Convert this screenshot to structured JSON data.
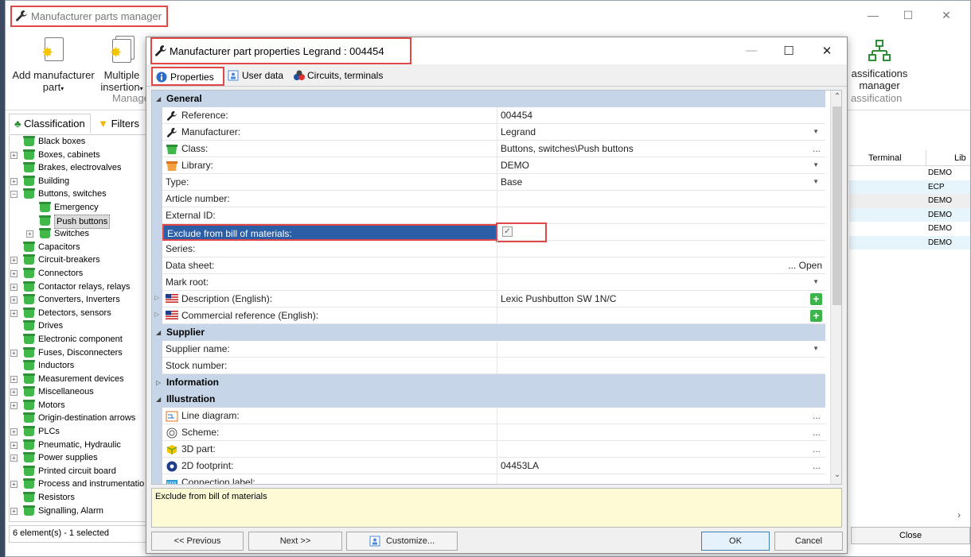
{
  "bg_window": {
    "title": "Manufacturer parts manager",
    "ribbon": {
      "add_manufacturer_part": [
        "Add manufacturer",
        "part"
      ],
      "multiple_insertion": [
        "Multiple",
        "insertion"
      ],
      "group_label": "Manage",
      "classifications_manager": [
        "assifications",
        "manager"
      ],
      "classification_label": "assification"
    },
    "left_tabs": [
      "Classification",
      "Filters"
    ],
    "tree": [
      {
        "label": "Black boxes",
        "level": 1,
        "expander": ""
      },
      {
        "label": "Boxes, cabinets",
        "level": 1,
        "expander": "+"
      },
      {
        "label": "Brakes, electrovalves",
        "level": 1,
        "expander": ""
      },
      {
        "label": "Building",
        "level": 1,
        "expander": "+"
      },
      {
        "label": "Buttons, switches",
        "level": 1,
        "expander": "−"
      },
      {
        "label": "Emergency",
        "level": 2,
        "expander": ""
      },
      {
        "label": "Push buttons",
        "level": 2,
        "expander": "",
        "selected": true
      },
      {
        "label": "Switches",
        "level": 2,
        "expander": "+"
      },
      {
        "label": "Capacitors",
        "level": 1,
        "expander": ""
      },
      {
        "label": "Circuit-breakers",
        "level": 1,
        "expander": "+"
      },
      {
        "label": "Connectors",
        "level": 1,
        "expander": "+"
      },
      {
        "label": "Contactor relays, relays",
        "level": 1,
        "expander": "+"
      },
      {
        "label": "Converters, Inverters",
        "level": 1,
        "expander": "+"
      },
      {
        "label": "Detectors, sensors",
        "level": 1,
        "expander": "+"
      },
      {
        "label": "Drives",
        "level": 1,
        "expander": ""
      },
      {
        "label": "Electronic component",
        "level": 1,
        "expander": ""
      },
      {
        "label": "Fuses, Disconnecters",
        "level": 1,
        "expander": "+"
      },
      {
        "label": "Inductors",
        "level": 1,
        "expander": ""
      },
      {
        "label": "Measurement devices",
        "level": 1,
        "expander": "+"
      },
      {
        "label": "Miscellaneous",
        "level": 1,
        "expander": "+"
      },
      {
        "label": "Motors",
        "level": 1,
        "expander": "+"
      },
      {
        "label": "Origin-destination arrows",
        "level": 1,
        "expander": ""
      },
      {
        "label": "PLCs",
        "level": 1,
        "expander": "+"
      },
      {
        "label": "Pneumatic, Hydraulic",
        "level": 1,
        "expander": "+"
      },
      {
        "label": "Power supplies",
        "level": 1,
        "expander": "+"
      },
      {
        "label": "Printed circuit board",
        "level": 1,
        "expander": ""
      },
      {
        "label": "Process and instrumentatio",
        "level": 1,
        "expander": "+"
      },
      {
        "label": "Resistors",
        "level": 1,
        "expander": ""
      },
      {
        "label": "Signalling, Alarm",
        "level": 1,
        "expander": "+"
      }
    ],
    "status": "6 element(s) - 1 selected",
    "right_table": {
      "headers": [
        "Terminal",
        "Lib"
      ],
      "rows": [
        "DEMO",
        "ECP",
        "DEMO",
        "DEMO",
        "DEMO",
        "DEMO"
      ]
    },
    "close_label": "Close"
  },
  "dialog": {
    "title": "Manufacturer part properties Legrand : 004454",
    "tabs": [
      "Properties",
      "User data",
      "Circuits, terminals"
    ],
    "categories": {
      "general": "General",
      "supplier": "Supplier",
      "information": "Information",
      "illustration": "Illustration"
    },
    "general_rows": [
      {
        "name": "Reference:",
        "value": "004454",
        "icon": "wrench-icon"
      },
      {
        "name": "Manufacturer:",
        "value": "Legrand",
        "icon": "wrench-icon",
        "control": "dropdown"
      },
      {
        "name": "Class:",
        "value": "Buttons, switches\\Push buttons",
        "icon": "green-bucket-icon",
        "control": "dots"
      },
      {
        "name": "Library:",
        "value": "DEMO",
        "icon": "orange-bucket-icon",
        "control": "dropdown"
      },
      {
        "name": "Type:",
        "value": "Base",
        "control": "dropdown"
      },
      {
        "name": "Article number:",
        "value": ""
      },
      {
        "name": "External ID:",
        "value": ""
      },
      {
        "name": "Exclude from bill of materials:",
        "value": "",
        "control": "checkbox",
        "checked": true,
        "selected": true
      },
      {
        "name": "Series:",
        "value": ""
      },
      {
        "name": "Data sheet:",
        "value": "",
        "control": "open",
        "open_label": "... Open"
      },
      {
        "name": "Mark root:",
        "value": "",
        "control": "dropdown"
      },
      {
        "name": "Description (English):",
        "value": "Lexic Pushbutton SW 1N/C",
        "icon": "us-flag-icon",
        "control": "plus"
      },
      {
        "name": "Commercial reference (English):",
        "value": "",
        "icon": "us-flag-icon",
        "control": "plus"
      }
    ],
    "supplier_rows": [
      {
        "name": "Supplier name:",
        "value": "",
        "control": "dropdown"
      },
      {
        "name": "Stock number:",
        "value": ""
      }
    ],
    "illustration_rows": [
      {
        "name": "Line diagram:",
        "value": "",
        "icon": "line-diagram-icon",
        "control": "dots"
      },
      {
        "name": "Scheme:",
        "value": "",
        "icon": "scheme-icon",
        "control": "dots"
      },
      {
        "name": "3D part:",
        "value": "",
        "icon": "3d-part-icon",
        "control": "dots"
      },
      {
        "name": "2D footprint:",
        "value": "04453LA",
        "icon": "footprint-icon",
        "control": "dots"
      },
      {
        "name": "Connection label:",
        "value": "",
        "icon": "connection-label-icon",
        "control": "dots"
      }
    ],
    "description_panel": "Exclude from bill of materials",
    "buttons": {
      "previous": "<< Previous",
      "next": "Next >>",
      "customize": "Customize...",
      "ok": "OK",
      "cancel": "Cancel"
    }
  },
  "colors": {
    "category_bg": "#c6d6e8",
    "selection": "#2a5ea6",
    "highlight_box": "#e04848",
    "desc_bg": "#fdfbd6"
  }
}
